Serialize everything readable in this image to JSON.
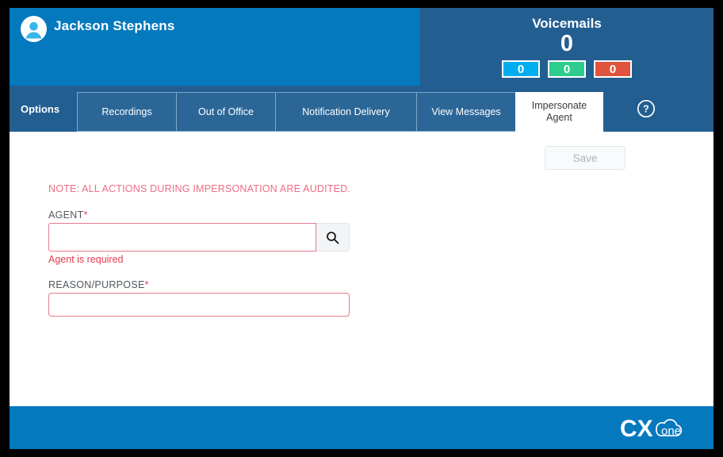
{
  "header": {
    "avatar_icon": "user-avatar-icon",
    "user_name": "Jackson Stephens",
    "voicemails": {
      "title": "Voicemails",
      "total": "0",
      "badges": [
        {
          "name": "new",
          "value": "0",
          "color": "#00aeef"
        },
        {
          "name": "saved",
          "value": "0",
          "color": "#2ecc8f"
        },
        {
          "name": "urgent",
          "value": "0",
          "color": "#e0533d"
        }
      ]
    }
  },
  "tabbar": {
    "options_label": "Options",
    "help_icon": "question-mark-circle-icon",
    "tabs": [
      {
        "label": "Recordings",
        "active": false
      },
      {
        "label": "Out of Office",
        "active": false
      },
      {
        "label": "Notification Delivery",
        "active": false
      },
      {
        "label": "View Messages",
        "active": false
      },
      {
        "label": "Impersonate Agent",
        "active": true
      }
    ]
  },
  "content": {
    "save_label": "Save",
    "note": "NOTE: ALL ACTIONS DURING IMPERSONATION ARE AUDITED.",
    "agent": {
      "label": "AGENT",
      "required_marker": "*",
      "value": "",
      "placeholder": "",
      "search_icon": "search-icon",
      "error": "Agent is required"
    },
    "reason": {
      "label": "REASON/PURPOSE",
      "required_marker": "*",
      "value": "",
      "placeholder": ""
    }
  },
  "footer": {
    "logo_text": "CXone",
    "logo_icon": "cxone-logo"
  },
  "colors": {
    "header_primary": "#0479be",
    "header_secondary": "#235e91",
    "tab_fill": "#2b6697",
    "accent_red": "#e8394f",
    "note_red": "#ed6c85"
  }
}
